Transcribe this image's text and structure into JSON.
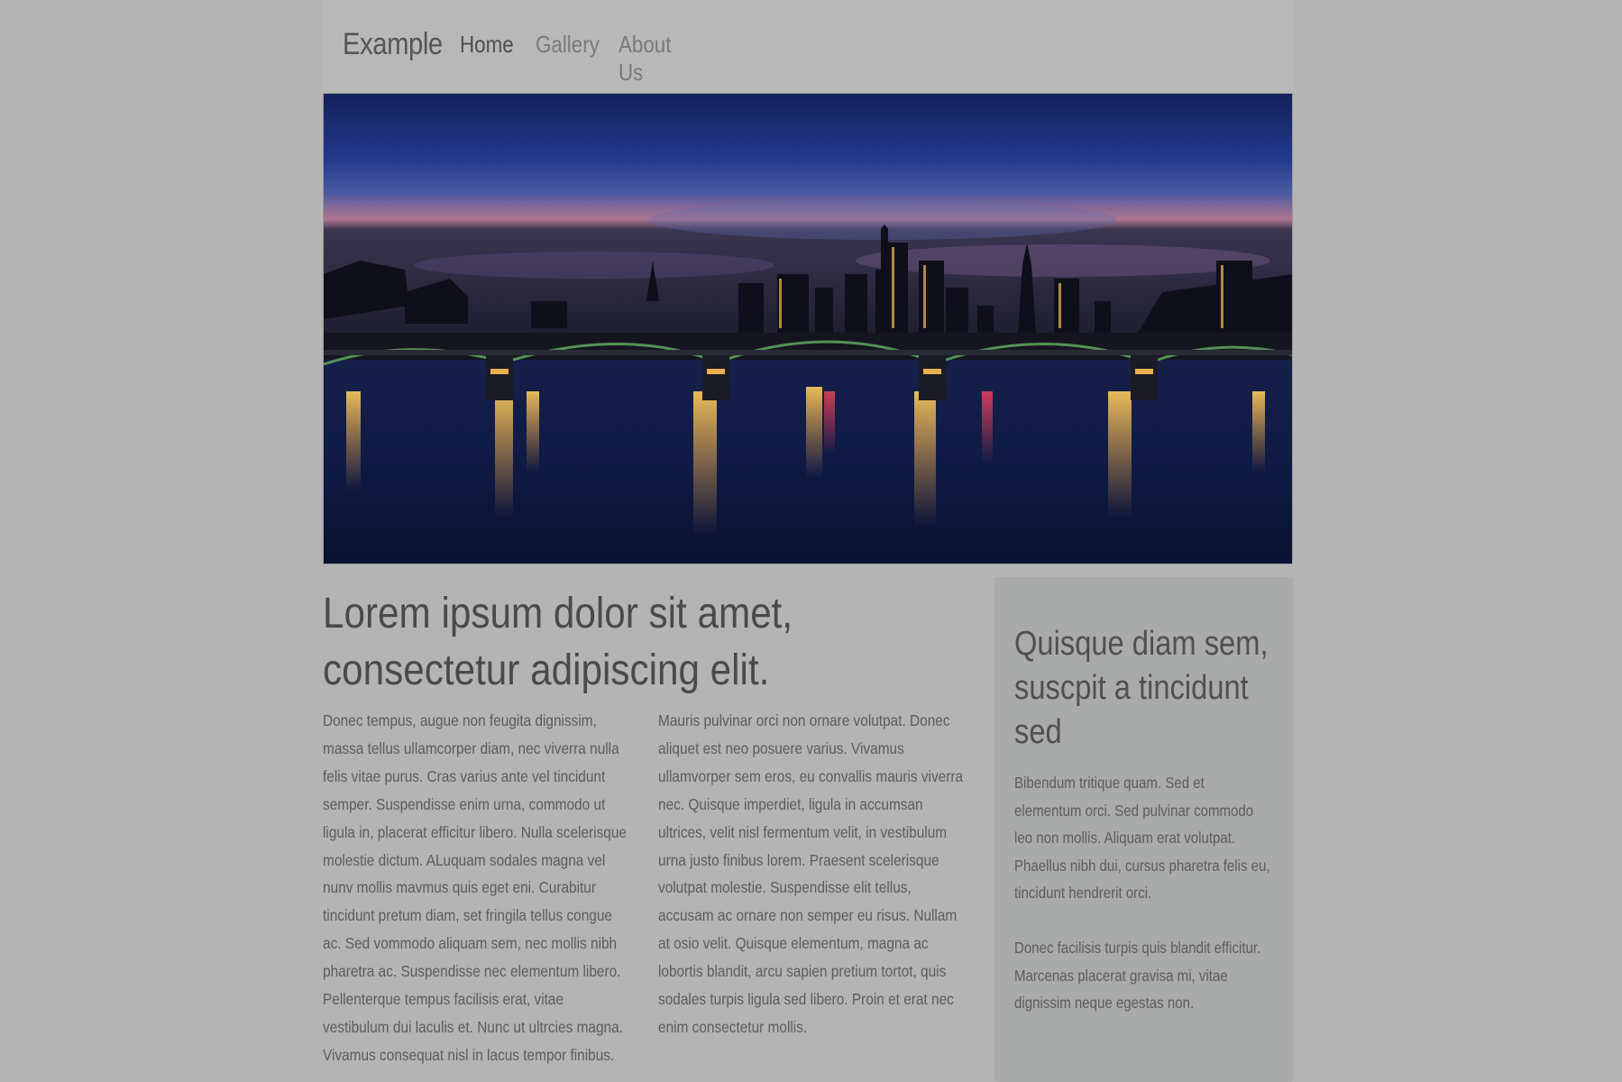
{
  "navbar": {
    "brand": "Example",
    "links": [
      {
        "label": "Home"
      },
      {
        "label": "Gallery"
      },
      {
        "label": "About Us"
      }
    ]
  },
  "main": {
    "title": "Lorem ipsum dolor sit amet, consectetur adipiscing elit.",
    "paragraphs": [
      "Donec tempus, augue non feugita dignissim, massa tellus ullamcorper diam, nec viverra nulla felis vitae purus. Cras varius ante vel tincidunt semper. Suspendisse enim urna, commodo ut ligula in, placerat efficitur libero. Nulla scelerisque molestie dictum. ALuquam sodales magna vel nunv mollis mavmus quis eget eni. Curabitur tincidunt pretum diam, set fringila tellus congue ac. Sed vommodo aliquam sem, nec mollis nibh pharetra ac. Suspendisse nec elementum libero. Pellenterque tempus facilisis erat, vitae vestibulum dui laculis et. Nunc ut ultrcies magna. Vivamus consequat nisl in lacus tempor finibus.",
      "Mauris pulvinar orci non ornare volutpat. Donec aliquet est neo posuere varius. Vivamus ullamvorper sem eros, eu convallis mauris viverra nec. Quisque imperdiet, ligula in accumsan ultrices, velit nisl fermentum velit, in vestibulum urna justo finibus lorem. Praesent scelerisque volutpat molestie. Suspendisse elit tellus, accusam ac ornare non semper eu risus. Nullam at osio velit. Quisque elementum, magna ac lobortis blandit, arcu sapien pretium tortot, quis sodales turpis ligula sed libero. Proin et erat nec enim consectetur mollis."
    ]
  },
  "aside": {
    "title": "Quisque diam sem, suscpit a tincidunt sed",
    "paragraphs": [
      "Bibendum tritique quam. Sed et elementum orci. Sed pulvinar commodo leo non mollis. Aliquam erat volutpat. Phaellus nibh dui, cursus pharetra felis eu, tincidunt hendrerit orci.",
      "Donec facilisis turpis quis blandit efficitur. Marcenas placerat gravisa mi, vitae dignissim neque egestas non."
    ]
  }
}
